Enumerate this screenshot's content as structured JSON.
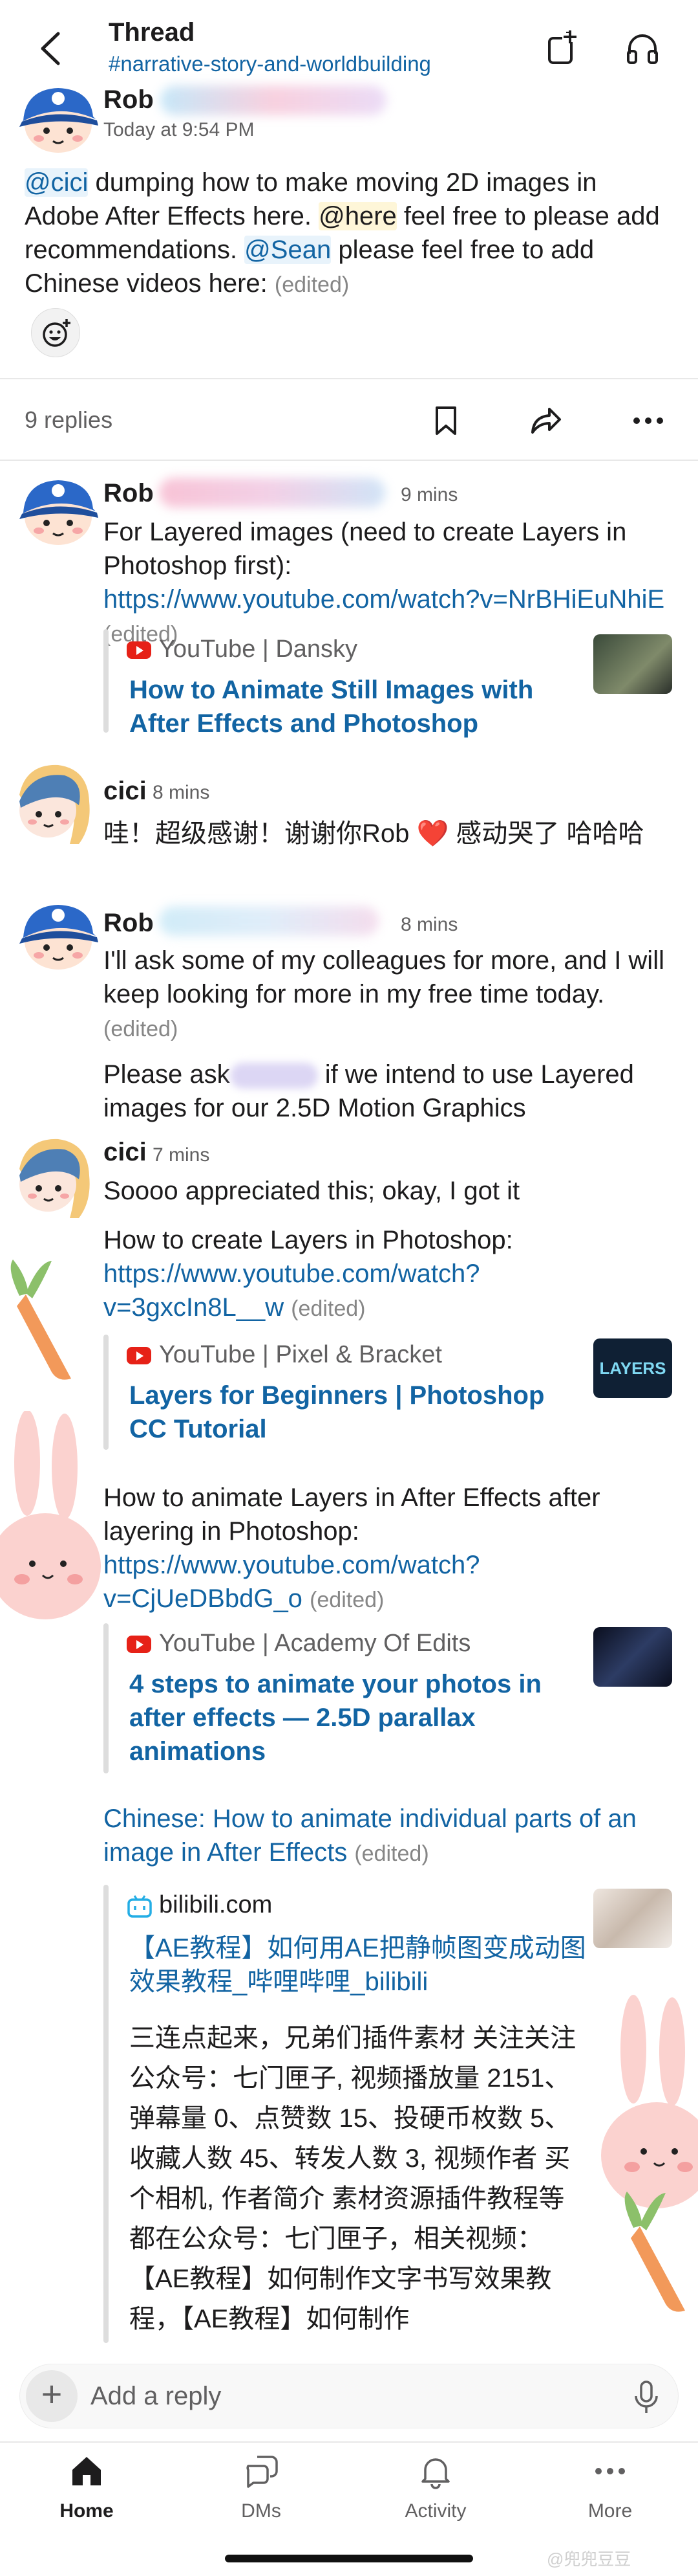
{
  "header": {
    "title": "Thread",
    "channel": "#narrative-story-and-worldbuilding"
  },
  "parent": {
    "author": "Rob",
    "time": "Today at 9:54 PM",
    "text_part1": "dumping how to make moving 2D images in Adobe After Effects here.",
    "mention_cici": "@cici",
    "mention_here": "@here",
    "text_part2": "feel free to please add recommendations.",
    "mention_sean": "@Sean",
    "text_part3": "please feel free to add Chinese videos here:",
    "edited": "(edited)"
  },
  "replies_bar": {
    "count": "9 replies"
  },
  "messages": [
    {
      "author": "Rob",
      "time": "9 mins",
      "text": "For Layered images (need to create Layers in Photoshop first):",
      "link": "https://www.youtube.com/watch?v=NrBHiEuNhiE",
      "edited": "(edited)",
      "attachment": {
        "source": "YouTube | Dansky",
        "title": "How to Animate Still Images with After Effects and Photoshop"
      }
    },
    {
      "author": "cici",
      "time": "8 mins",
      "text": "哇！超级感谢！谢谢你Rob ❤️ 感动哭了 哈哈哈"
    },
    {
      "author": "Rob",
      "time": "8 mins",
      "text": "I'll ask some of my colleagues for more, and I will keep looking for more in my free time today.",
      "edited": "(edited)",
      "text2": "Please ask",
      "text2b": "if we intend to use Layered images for our 2.5D Motion Graphics"
    },
    {
      "author": "cici",
      "time": "7 mins",
      "text": "Soooo appreciated this; okay, I got it",
      "text2": "How to create Layers in Photoshop:",
      "link2": "https://www.youtube.com/watch?v=3gxcIn8L__w",
      "edited2": "(edited)",
      "attachment1": {
        "source": "YouTube | Pixel & Bracket",
        "title": "Layers for Beginners | Photoshop CC Tutorial",
        "thumb_text": "LAYERS"
      },
      "text3": "How to animate Layers in After Effects after layering in Photoshop:",
      "link3": "https://www.youtube.com/watch?v=CjUeDBbdG_o",
      "edited3": "(edited)",
      "attachment2": {
        "source": "YouTube | Academy Of Edits",
        "title": "4 steps to animate your photos in after effects — 2.5D parallax animations"
      },
      "text4": "Chinese: How to animate individual parts of an image in After Effects",
      "edited4": "(edited)",
      "attachment3": {
        "source": "bilibili.com",
        "title": "【AE教程】如何用AE把静帧图变成动图效果教程_哔哩哔哩_bilibili",
        "desc": "三连点起来，兄弟们插件素材 关注关注公众号：七门匣子, 视频播放量 2151、弹幕量 0、点赞数 15、投硬币枚数 5、收藏人数 45、转发人数 3, 视频作者 买个相机, 作者简介 素材资源插件教程等都在公众号：七门匣子，相关视频：【AE教程】如何制作文字书写效果教程，【AE教程】如何制作"
      }
    }
  ],
  "composer": {
    "placeholder": "Add a reply"
  },
  "nav": {
    "items": [
      "Home",
      "DMs",
      "Activity",
      "More"
    ],
    "active": "Home"
  },
  "watermark": "@兜兜豆豆",
  "colors": {
    "link": "#1264a3",
    "mention_bg": "#e8f3fb",
    "here_bg": "#fef6d8",
    "youtube_red": "#e62117",
    "bilibili_blue": "#23ade5"
  }
}
